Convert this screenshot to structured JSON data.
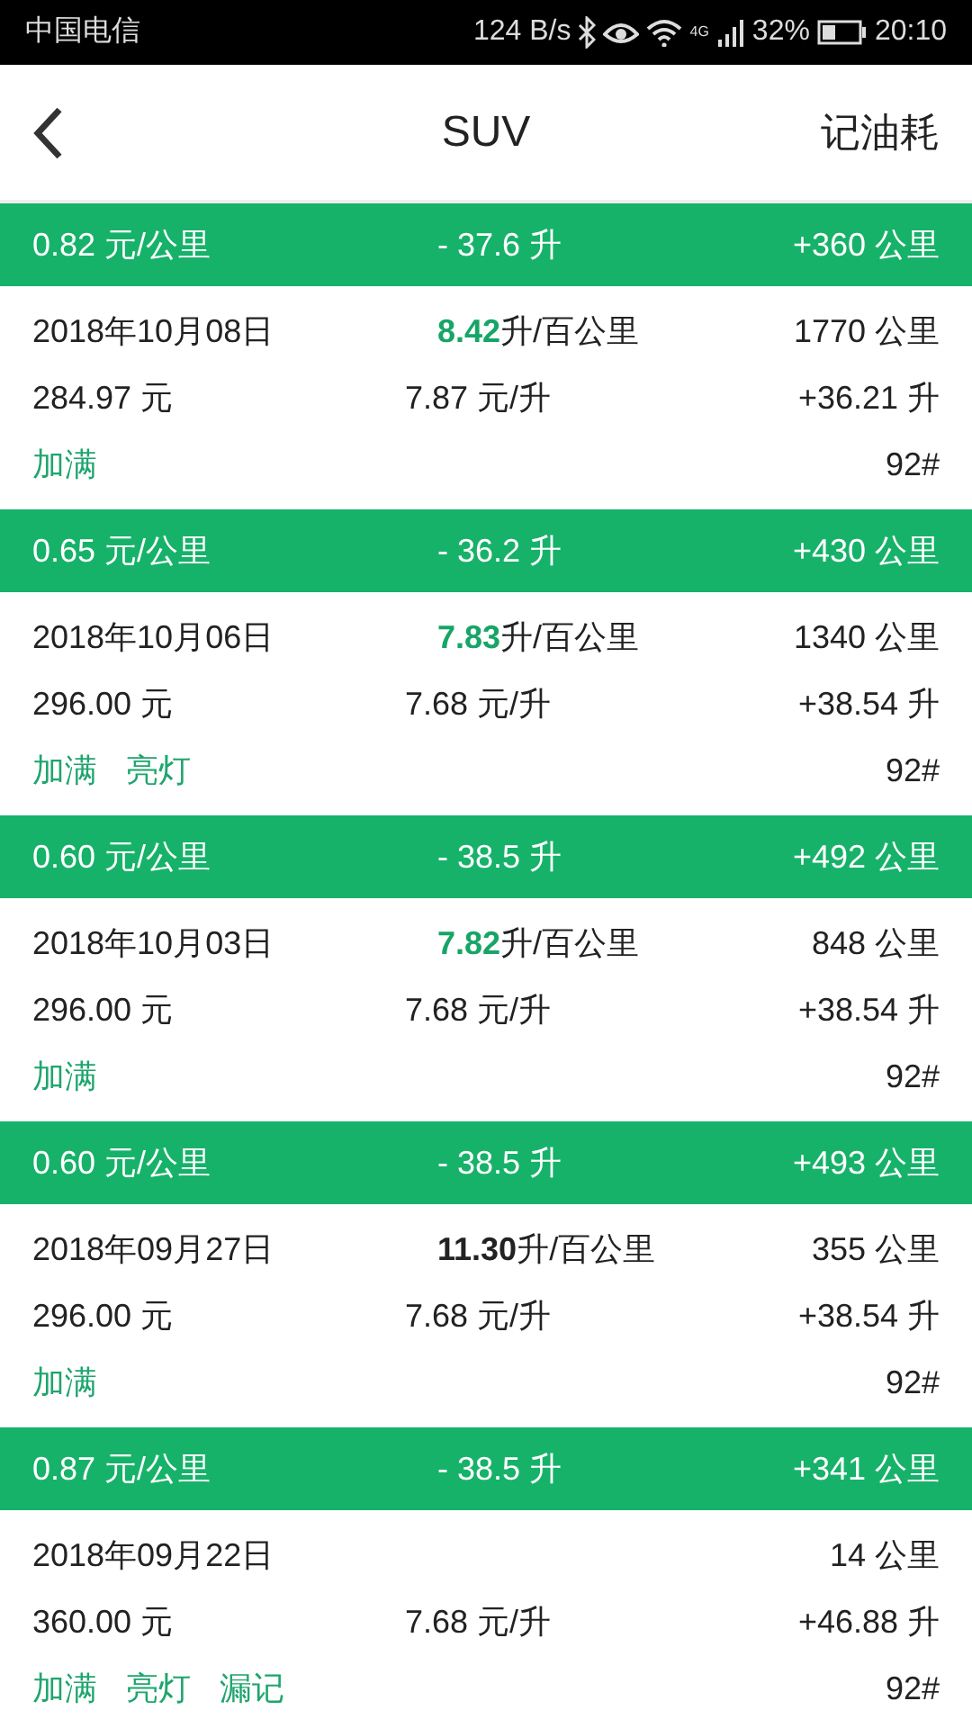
{
  "status_bar": {
    "carrier": "中国电信",
    "speed": "124 B/s",
    "network": "4G",
    "battery": "32%",
    "time": "20:10"
  },
  "header": {
    "title": "SUV",
    "action": "记油耗"
  },
  "entries": [
    {
      "summary": {
        "cost": "0.82 元/公里",
        "fuel": "- 37.6 升",
        "distance": "+360 公里"
      },
      "date": "2018年10月08日",
      "consumption": {
        "value": "8.42",
        "unit": "升/百公里",
        "good": true
      },
      "amount": "284.97 元",
      "price": "7.87 元/升",
      "odometer": "1770 公里",
      "added": "+36.21 升",
      "tags": [
        "加满"
      ],
      "grade": "92#"
    },
    {
      "summary": {
        "cost": "0.65 元/公里",
        "fuel": "- 36.2 升",
        "distance": "+430 公里"
      },
      "date": "2018年10月06日",
      "consumption": {
        "value": "7.83",
        "unit": "升/百公里",
        "good": true
      },
      "amount": "296.00 元",
      "price": "7.68 元/升",
      "odometer": "1340 公里",
      "added": "+38.54 升",
      "tags": [
        "加满",
        "亮灯"
      ],
      "grade": "92#"
    },
    {
      "summary": {
        "cost": "0.60 元/公里",
        "fuel": "- 38.5 升",
        "distance": "+492 公里"
      },
      "date": "2018年10月03日",
      "consumption": {
        "value": "7.82",
        "unit": "升/百公里",
        "good": true
      },
      "amount": "296.00 元",
      "price": "7.68 元/升",
      "odometer": "848 公里",
      "added": "+38.54 升",
      "tags": [
        "加满"
      ],
      "grade": "92#"
    },
    {
      "summary": {
        "cost": "0.60 元/公里",
        "fuel": "- 38.5 升",
        "distance": "+493 公里"
      },
      "date": "2018年09月27日",
      "consumption": {
        "value": "11.30",
        "unit": "升/百公里",
        "good": false
      },
      "amount": "296.00 元",
      "price": "7.68 元/升",
      "odometer": "355 公里",
      "added": "+38.54 升",
      "tags": [
        "加满"
      ],
      "grade": "92#"
    },
    {
      "summary": {
        "cost": "0.87 元/公里",
        "fuel": "- 38.5 升",
        "distance": "+341 公里"
      },
      "date": "2018年09月22日",
      "amount": "360.00 元",
      "price": "7.68 元/升",
      "odometer": "14 公里",
      "added": "+46.88 升",
      "tags": [
        "加满",
        "亮灯",
        "漏记"
      ],
      "grade": "92#"
    }
  ]
}
